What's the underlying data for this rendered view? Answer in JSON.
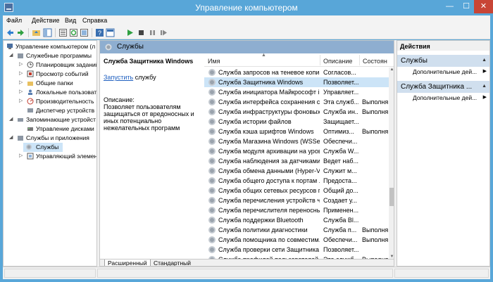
{
  "window": {
    "title": "Управление компьютером",
    "min": "—",
    "max": "☐",
    "close": "✕"
  },
  "menu": [
    "Файл",
    "Действие",
    "Вид",
    "Справка"
  ],
  "tree": [
    {
      "label": "Управление компьютером (л",
      "arrow": ""
    },
    {
      "label": "Служебные программы",
      "arrow": "◢"
    },
    {
      "label": "Планировщик заданий",
      "arrow": "▷"
    },
    {
      "label": "Просмотр событий",
      "arrow": "▷"
    },
    {
      "label": "Общие папки",
      "arrow": "▷"
    },
    {
      "label": "Локальные пользовате",
      "arrow": "▷"
    },
    {
      "label": "Производительность",
      "arrow": "▷"
    },
    {
      "label": "Диспетчер устройств",
      "arrow": ""
    },
    {
      "label": "Запоминающие устройст",
      "arrow": "◢"
    },
    {
      "label": "Управление дисками",
      "arrow": ""
    },
    {
      "label": "Службы и приложения",
      "arrow": "◢"
    },
    {
      "label": "Службы",
      "arrow": ""
    },
    {
      "label": "Управляющий элемен",
      "arrow": "▷"
    }
  ],
  "center": {
    "header": "Службы",
    "selected_title": "Служба Защитника Windows",
    "start_link": "Запустить",
    "start_rest": " службу",
    "desc_label": "Описание:",
    "desc_text": "Позволяет пользователям защищаться от вредоносных и иных потенциально нежелательных программ"
  },
  "columns": {
    "name": "Имя",
    "desc": "Описание",
    "status": "Состоян"
  },
  "services": [
    {
      "name": "Служба запросов на теневое копир...",
      "desc": "Согласов...",
      "status": ""
    },
    {
      "name": "Служба Защитника Windows",
      "desc": "Позволяет...",
      "status": ""
    },
    {
      "name": "Служба инициатора Майкрософт iS...",
      "desc": "Управляет...",
      "status": ""
    },
    {
      "name": "Служба интерфейса сохранения сети",
      "desc": "Эта служб...",
      "status": "Выполня"
    },
    {
      "name": "Служба инфраструктуры фоновых ...",
      "desc": "Служба ин...",
      "status": "Выполня"
    },
    {
      "name": "Служба истории файлов",
      "desc": "Защищает...",
      "status": ""
    },
    {
      "name": "Служба кэша шрифтов Windows",
      "desc": "Оптимиз...",
      "status": "Выполня"
    },
    {
      "name": "Служба Магазина Windows (WSServ...",
      "desc": "Обеспечи...",
      "status": ""
    },
    {
      "name": "Служба модуля архивации на уров...",
      "desc": "Служба W...",
      "status": ""
    },
    {
      "name": "Служба наблюдения за датчиками",
      "desc": "Ведет наб...",
      "status": ""
    },
    {
      "name": "Служба обмена данными (Hyper-V)",
      "desc": "Служит м...",
      "status": ""
    },
    {
      "name": "Служба общего доступа к портам ...",
      "desc": "Предоста...",
      "status": ""
    },
    {
      "name": "Служба общих сетевых ресурсов п...",
      "desc": "Общий до...",
      "status": ""
    },
    {
      "name": "Служба перечисления устройств чт...",
      "desc": "Создает у...",
      "status": ""
    },
    {
      "name": "Служба перечислителя переносны...",
      "desc": "Применен...",
      "status": ""
    },
    {
      "name": "Служба поддержки Bluetooth",
      "desc": "Служба Bl...",
      "status": ""
    },
    {
      "name": "Служба политики диагностики",
      "desc": "Служба п...",
      "status": "Выполня"
    },
    {
      "name": "Служба помощника по совместим...",
      "desc": "Обеспечи...",
      "status": "Выполня"
    },
    {
      "name": "Служба проверки сети Защитника ...",
      "desc": "Позволяет...",
      "status": ""
    },
    {
      "name": "Служба профилей пользователей",
      "desc": "Эта служб...",
      "status": "Выполня"
    }
  ],
  "tabs": {
    "extended": "Расширенный",
    "standard": "Стандартный"
  },
  "actions": {
    "header": "Действия",
    "section1": "Службы",
    "section1_item": "Дополнительные дей...",
    "section2": "Служба Защитника ...",
    "section2_item": "Дополнительные дей..."
  },
  "colors": {
    "title_bar": "#58a6d8",
    "selection": "#cce4f7",
    "close_button": "#c84536",
    "pane_header": "#8eaed0"
  }
}
